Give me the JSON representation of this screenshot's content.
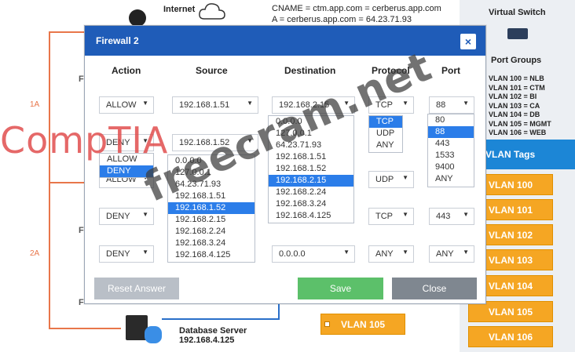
{
  "diagram": {
    "internet_label": "Internet",
    "cname_line": "CNAME = ctm.app.com = cerberus.app.com",
    "a_line": "A = cerberus.app.com = 64.23.71.93",
    "label_1a": "1A",
    "label_2a": "2A",
    "f_letter": "F",
    "database_server": "Database Server",
    "database_ip": "192.168.4.125",
    "vlan105": "VLAN 105"
  },
  "virtual_switch": {
    "title": "Virtual Switch",
    "port_groups_title": "Port Groups",
    "port_groups": [
      "VLAN 100 = NLB",
      "VLAN 101 = CTM",
      "VLAN 102 = BI",
      "VLAN 103 = CA",
      "VLAN 104 = DB",
      "VLAN 105 = MGMT",
      "VLAN 106 = WEB"
    ],
    "vlan_tags_title": "VLAN Tags",
    "vlan_tags": [
      "VLAN 100",
      "VLAN 101",
      "VLAN 102",
      "VLAN 103",
      "VLAN 104",
      "VLAN 105",
      "VLAN 106"
    ]
  },
  "modal": {
    "title": "Firewall 2",
    "close_icon": "×",
    "columns": {
      "action": "Action",
      "source": "Source",
      "destination": "Destination",
      "protocol": "Protocol",
      "port": "Port"
    },
    "rows": [
      {
        "action": "ALLOW",
        "source": "192.168.1.51",
        "destination": "192.168.2.15",
        "protocol": "TCP",
        "port": "88"
      },
      {
        "action": "DENY",
        "source": "192.168.1.52",
        "destination": "",
        "protocol": "",
        "port": ""
      },
      {
        "action": "ALLOW",
        "source": "",
        "destination": "",
        "protocol": "UDP",
        "port": ""
      },
      {
        "action": "DENY",
        "source": "",
        "destination": "",
        "protocol": "TCP",
        "port": "443"
      },
      {
        "action": "DENY",
        "source": "",
        "destination": "0.0.0.0",
        "protocol": "ANY",
        "port": "ANY"
      }
    ],
    "action_dropdown": {
      "options": [
        "ALLOW",
        "DENY"
      ],
      "selected": "DENY"
    },
    "source_dropdown": {
      "options": [
        "0.0.0.0",
        "127.0.0.1",
        "64.23.71.93",
        "192.168.1.51",
        "192.168.1.52",
        "192.168.2.15",
        "192.168.2.24",
        "192.168.3.24",
        "192.168.4.125"
      ],
      "selected": "192.168.1.52"
    },
    "destination_dropdown": {
      "options": [
        "0.0.0.0",
        "127.0.0.1",
        "64.23.71.93",
        "192.168.1.51",
        "192.168.1.52",
        "192.168.2.15",
        "192.168.2.24",
        "192.168.3.24",
        "192.168.4.125"
      ],
      "selected": "192.168.2.15"
    },
    "protocol_dropdown": {
      "options": [
        "TCP",
        "UDP",
        "ANY"
      ],
      "selected": "TCP"
    },
    "port_dropdown": {
      "options": [
        "80",
        "88",
        "443",
        "1533",
        "9400",
        "ANY"
      ],
      "selected": "88"
    },
    "buttons": {
      "reset": "Reset Answer",
      "save": "Save",
      "close": "Close"
    }
  },
  "watermarks": {
    "comptia": "CompTIA",
    "site": "freecram.net"
  },
  "colors": {
    "header": "#1f5cb8",
    "highlight": "#2b7de9",
    "vlan": "#f5a623",
    "save": "#5cc06a"
  }
}
